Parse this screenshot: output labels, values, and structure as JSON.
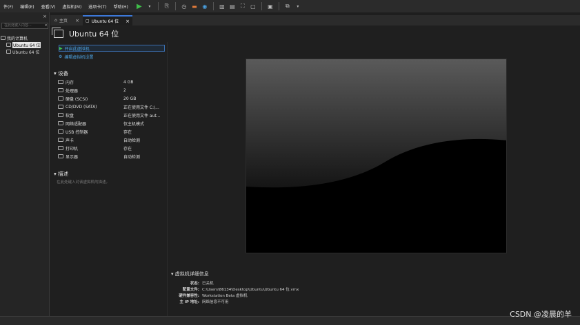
{
  "menu": [
    "件(F)",
    "编辑(E)",
    "查看(V)",
    "虚拟机(M)",
    "选项卡(T)",
    "帮助(H)"
  ],
  "toolbar_icons": [
    "play-icon",
    "dropdown-icon",
    "send-keys-icon",
    "snapshot-icon",
    "revert-icon",
    "snapshot-manager-icon",
    "view-library-icon",
    "view-thumbnail-icon",
    "fullscreen-icon",
    "unity-icon",
    "console-icon",
    "stretch-icon",
    "view-dropdown-icon"
  ],
  "sidebar": {
    "close": "×",
    "search_placeholder": "在此处键入内容...",
    "root": "我的计算机",
    "items": [
      "Ubuntu 64 位",
      "Ubuntu 64 位"
    ]
  },
  "tabs": [
    {
      "label": "主页",
      "close": "×"
    },
    {
      "label": "Ubuntu 64 位",
      "close": "×"
    }
  ],
  "vm": {
    "title": "Ubuntu 64 位",
    "actions": [
      "开启此虚拟机",
      "编辑虚拟机设置"
    ],
    "devices_header": "设备",
    "devices": [
      {
        "name": "内存",
        "value": "4 GB"
      },
      {
        "name": "处理器",
        "value": "2"
      },
      {
        "name": "硬盘 (SCSI)",
        "value": "20 GB"
      },
      {
        "name": "CD/DVD (SATA)",
        "value": "正在使用文件 C:\\..."
      },
      {
        "name": "软盘",
        "value": "正在使用文件 aut..."
      },
      {
        "name": "网络适配器",
        "value": "仅主机模式"
      },
      {
        "name": "USB 控制器",
        "value": "存在"
      },
      {
        "name": "声卡",
        "value": "自动检测"
      },
      {
        "name": "打印机",
        "value": "存在"
      },
      {
        "name": "显示器",
        "value": "自动检测"
      }
    ],
    "desc_header": "描述",
    "desc_placeholder": "在此处键入对该虚拟机的描述。",
    "details_header": "虚拟机详细信息",
    "details": [
      {
        "key": "状态:",
        "value": "已关机"
      },
      {
        "key": "配置文件:",
        "value": "C:\\Users\\86134\\Desktop\\Ubuntu\\Ubuntu 64 位.vmx"
      },
      {
        "key": "硬件兼容性:",
        "value": "Workstation Beta 虚拟机"
      },
      {
        "key": "主 IP 地址:",
        "value": "网络信息不可用"
      }
    ]
  },
  "watermark": "CSDN @凌晨的羊"
}
